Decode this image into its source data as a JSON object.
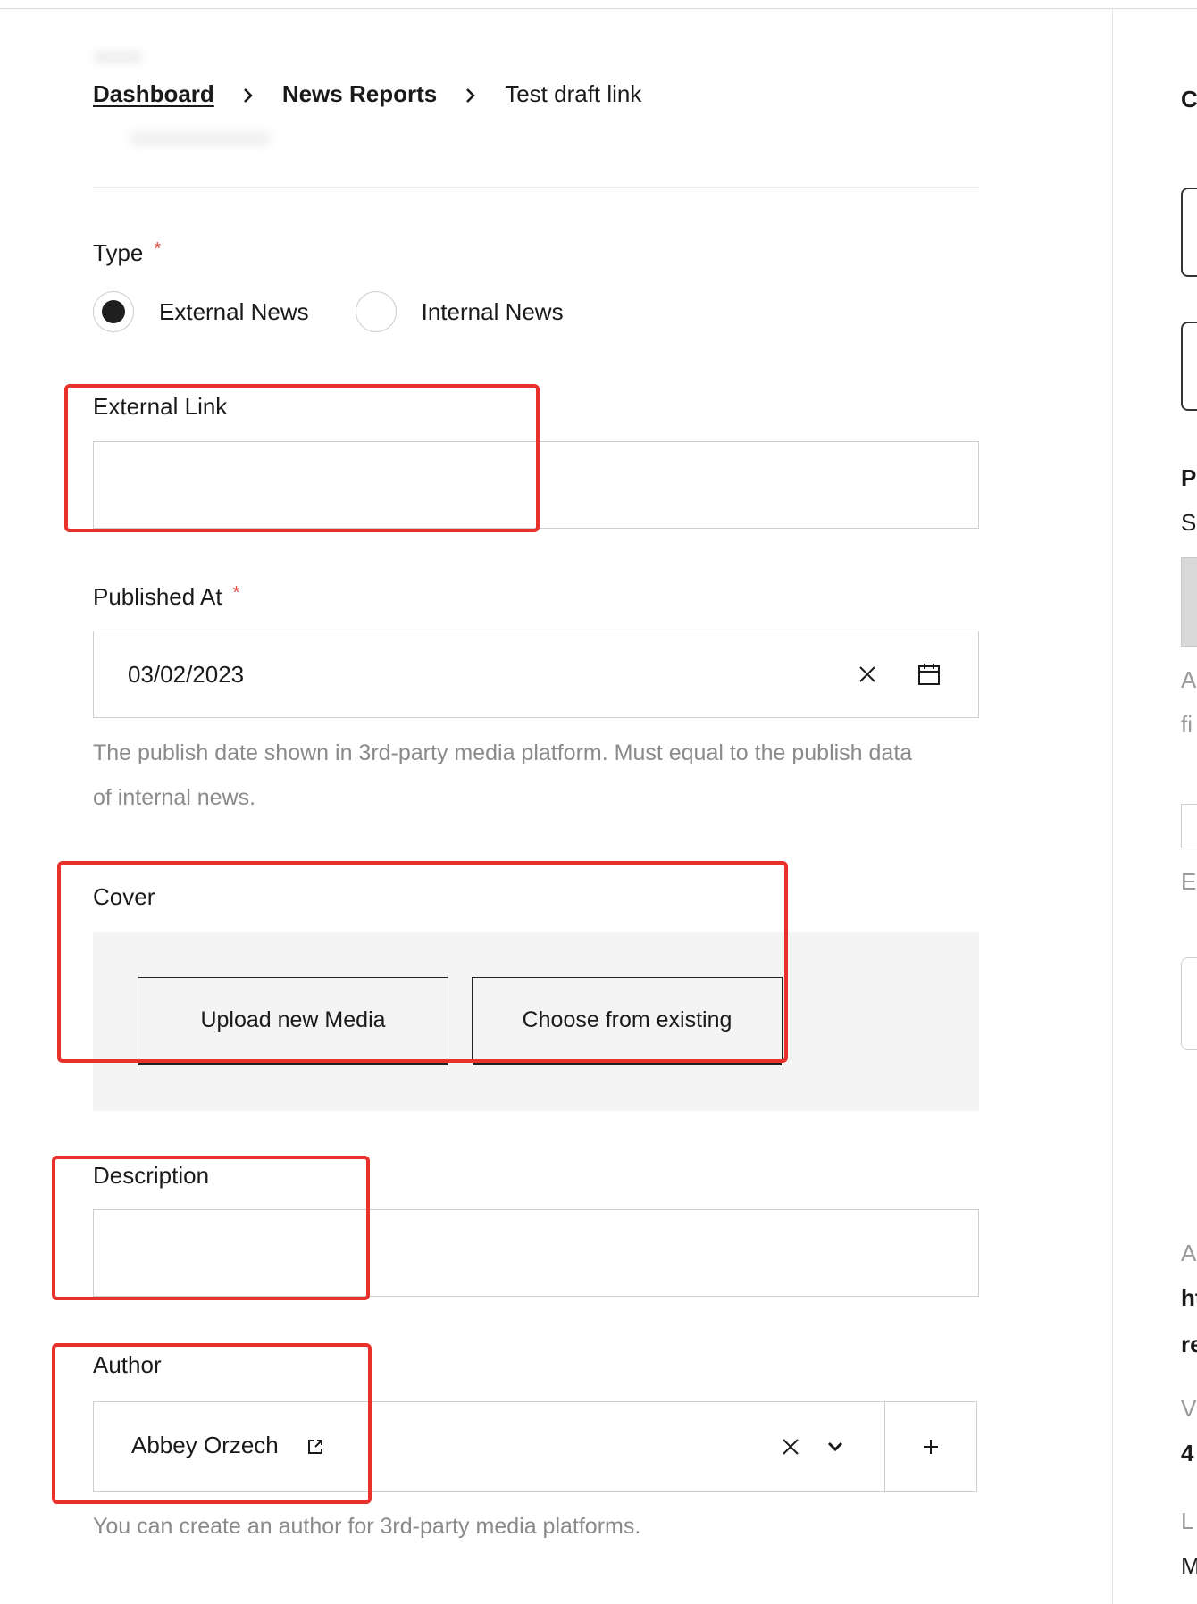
{
  "breadcrumb": {
    "dashboard": "Dashboard",
    "news_reports": "News Reports",
    "current": "Test draft link"
  },
  "type_field": {
    "label": "Type",
    "required_mark": "*",
    "options": [
      "External News",
      "Internal News"
    ],
    "selected": "External News"
  },
  "external_link": {
    "label": "External Link",
    "value": ""
  },
  "published_at": {
    "label": "Published At",
    "required_mark": "*",
    "value": "03/02/2023",
    "helper_line1": "The publish date shown in 3rd-party media platform. Must equal to the publish data",
    "helper_line2": "of internal news."
  },
  "cover": {
    "label": "Cover",
    "upload_button": "Upload new Media",
    "choose_button": "Choose from existing"
  },
  "description": {
    "label": "Description",
    "value": ""
  },
  "author": {
    "label": "Author",
    "value": "Abbey Orzech",
    "helper": "You can create an author for 3rd-party media platforms."
  },
  "right_panel": {
    "chars": [
      "C",
      "P",
      "S",
      "A",
      "fi",
      "E",
      "A",
      "ht",
      "re",
      "V",
      "4",
      "L",
      "M"
    ]
  },
  "colors": {
    "annotation": "#e8312a",
    "required": "#e2453c",
    "helper_text": "#8a8a8a",
    "cover_bg": "#f4f4f4"
  }
}
